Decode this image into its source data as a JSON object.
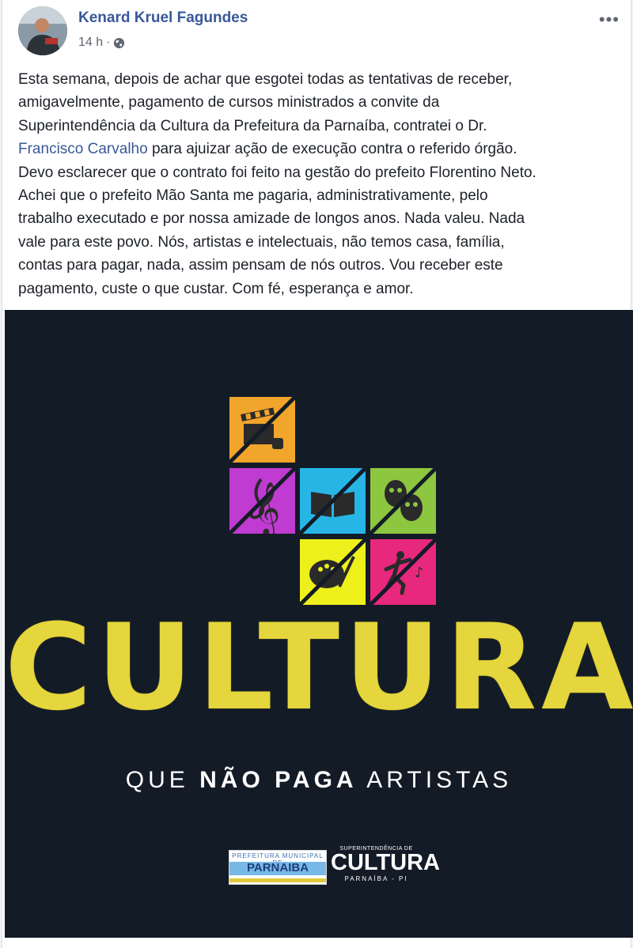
{
  "post": {
    "author": "Kenard Kruel Fagundes",
    "time": "14 h",
    "separator": "·",
    "privacy_icon": "globe-icon",
    "more_icon": "more-options-icon",
    "more_glyph": "•••",
    "text_lines": [
      "Esta semana, depois de achar que esgotei todas as tentativas de receber,",
      "amigavelmente, pagamento de cursos ministrados a convite da",
      "Superintendência da Cultura da Prefeitura da Parnaíba, contratei o Dr."
    ],
    "mention": "Francisco Carvalho",
    "mention_line_rest": " para ajuizar ação de execução contra o referido órgão.",
    "text_lines_after": [
      "Devo esclarecer que o contrato foi feito na gestão do prefeito Florentino Neto.",
      "Achei que o prefeito Mão Santa me pagaria, administrativamente, pelo",
      "trabalho executado e por nossa amizade de longos anos. Nada valeu. Nada",
      "vale para este povo. Nós, artistas e intelectuais, não temos casa, família,",
      "contas para pagar, nada, assim pensam de nós outros. Vou receber este",
      "pagamento, custe o que custar. Com fé, esperança e amor."
    ]
  },
  "image": {
    "headline": "CULTURA",
    "tagline_pre": "QUE ",
    "tagline_bold": "NÃO PAGA",
    "tagline_post": " ARTISTAS",
    "logo_left_top": "PREFEITURA MUNICIPAL DE",
    "logo_left_name": "PARNAIBA",
    "logo_right_top": "SUPERINTENDÊNCIA DE",
    "logo_right_main": "CULTURA",
    "logo_right_sub": "PARNAÍBA - PI",
    "tiles": [
      {
        "name": "cinema-tile",
        "icon": "clapperboard-icon",
        "color": "#f2a52b"
      },
      {
        "name": "music-tile",
        "icon": "treble-clef-icon",
        "color": "#c03bd1"
      },
      {
        "name": "literature-tile",
        "icon": "book-icon",
        "color": "#27b5e6"
      },
      {
        "name": "theater-tile",
        "icon": "theater-masks-icon",
        "color": "#8dc63f"
      },
      {
        "name": "painting-tile",
        "icon": "palette-icon",
        "color": "#eef01b"
      },
      {
        "name": "dance-tile",
        "icon": "dancer-icon",
        "color": "#e7287c"
      }
    ]
  },
  "colors": {
    "link": "#385898",
    "text": "#1d2129",
    "meta": "#616770",
    "image_bg": "#131b27",
    "headline": "#e4d63c"
  }
}
